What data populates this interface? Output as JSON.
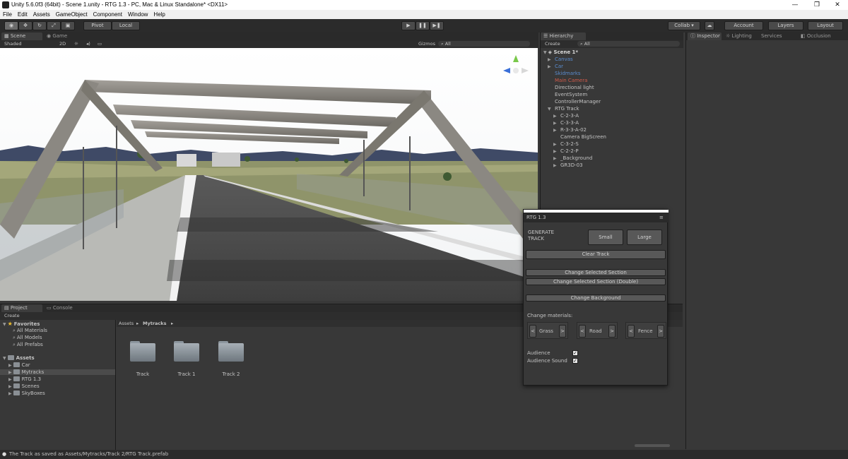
{
  "window": {
    "title": "Unity 5.6.0f3 (64bit) - Scene 1.unity - RTG 1.3 - PC, Mac & Linux Standalone* <DX11>",
    "minimize": "—",
    "maximize": "❐",
    "close": "✕"
  },
  "menu": [
    "File",
    "Edit",
    "Assets",
    "GameObject",
    "Component",
    "Window",
    "Help"
  ],
  "toolbar": {
    "pivot": "Pivot",
    "local": "Local",
    "play": "▶",
    "pause": "❚❚",
    "step": "▶❚",
    "collab": "Collab ▾",
    "account": "Account",
    "layers": "Layers",
    "layout": "Layout"
  },
  "scene_panel": {
    "tab_scene": "Scene",
    "tab_game": "Game",
    "shading": "Shaded",
    "mode2d": "2D",
    "gizmos": "Gizmos",
    "search": "All"
  },
  "hierarchy": {
    "tab": "Hierarchy",
    "create": "Create",
    "search": "All",
    "scene": "Scene 1*",
    "items": [
      {
        "label": "Canvas",
        "color": "#5a8ccf",
        "indent": 1,
        "arrow": "▶"
      },
      {
        "label": "Car",
        "color": "#5a8ccf",
        "indent": 1,
        "arrow": "▶"
      },
      {
        "label": "Skidmarks",
        "color": "#5a8ccf",
        "indent": 1,
        "arrow": ""
      },
      {
        "label": "Main Camera",
        "color": "#d05a4a",
        "indent": 1,
        "arrow": ""
      },
      {
        "label": "Directional light",
        "color": "#c4c4c4",
        "indent": 1,
        "arrow": ""
      },
      {
        "label": "EventSystem",
        "color": "#c4c4c4",
        "indent": 1,
        "arrow": ""
      },
      {
        "label": "ControllerManager",
        "color": "#c4c4c4",
        "indent": 1,
        "arrow": ""
      },
      {
        "label": "RTG Track",
        "color": "#c4c4c4",
        "indent": 1,
        "arrow": "▼"
      },
      {
        "label": "C-2-3-A",
        "color": "#c4c4c4",
        "indent": 2,
        "arrow": "▶"
      },
      {
        "label": "C-3-3-A",
        "color": "#c4c4c4",
        "indent": 2,
        "arrow": "▶"
      },
      {
        "label": "R-3-3-A-02",
        "color": "#c4c4c4",
        "indent": 2,
        "arrow": "▶"
      },
      {
        "label": "Camera BigScreen",
        "color": "#c4c4c4",
        "indent": 2,
        "arrow": ""
      },
      {
        "label": "C-3-2-S",
        "color": "#c4c4c4",
        "indent": 2,
        "arrow": "▶"
      },
      {
        "label": "C-2-2-P",
        "color": "#c4c4c4",
        "indent": 2,
        "arrow": "▶"
      },
      {
        "label": "_Background",
        "color": "#c4c4c4",
        "indent": 2,
        "arrow": "▶"
      },
      {
        "label": "GR3D-03",
        "color": "#c4c4c4",
        "indent": 2,
        "arrow": "▶"
      }
    ]
  },
  "inspector": {
    "tab_inspector": "Inspector",
    "tab_lighting": "Lighting",
    "tab_services": "Services",
    "tab_occlusion": "Occlusion"
  },
  "project": {
    "tab_project": "Project",
    "tab_console": "Console",
    "create": "Create",
    "breadcrumb_root": "Assets",
    "breadcrumb_sep": "▸",
    "breadcrumb_current": "Mytracks",
    "favorites_label": "Favorites",
    "favorites": [
      "All Materials",
      "All Models",
      "All Prefabs"
    ],
    "assets_label": "Assets",
    "asset_folders": [
      "Car",
      "Mytracks",
      "RTG 1.3",
      "Scenes",
      "SkyBoxes"
    ],
    "selected_folder": "Mytracks",
    "files": [
      "Track",
      "Track 1",
      "Track 2"
    ]
  },
  "rtg": {
    "title": "RTG 1.3",
    "generate_label_1": "GENERATE",
    "generate_label_2": "TRACK",
    "small": "Small",
    "large": "Large",
    "clear": "Clear Track",
    "change_section": "Change Selected Section",
    "change_section_double": "Change Selected Section (Double)",
    "change_background": "Change Background",
    "materials_label": "Change materials:",
    "materials": [
      "Grass",
      "Road",
      "Fence"
    ],
    "prev": "<",
    "next": ">",
    "audience": "Audience",
    "audience_sound": "Audience Sound",
    "checkmark": "✓"
  },
  "status": {
    "message": "The Track as saved as Assets/Mytracks/Track 2/RTG Track.prefab"
  }
}
